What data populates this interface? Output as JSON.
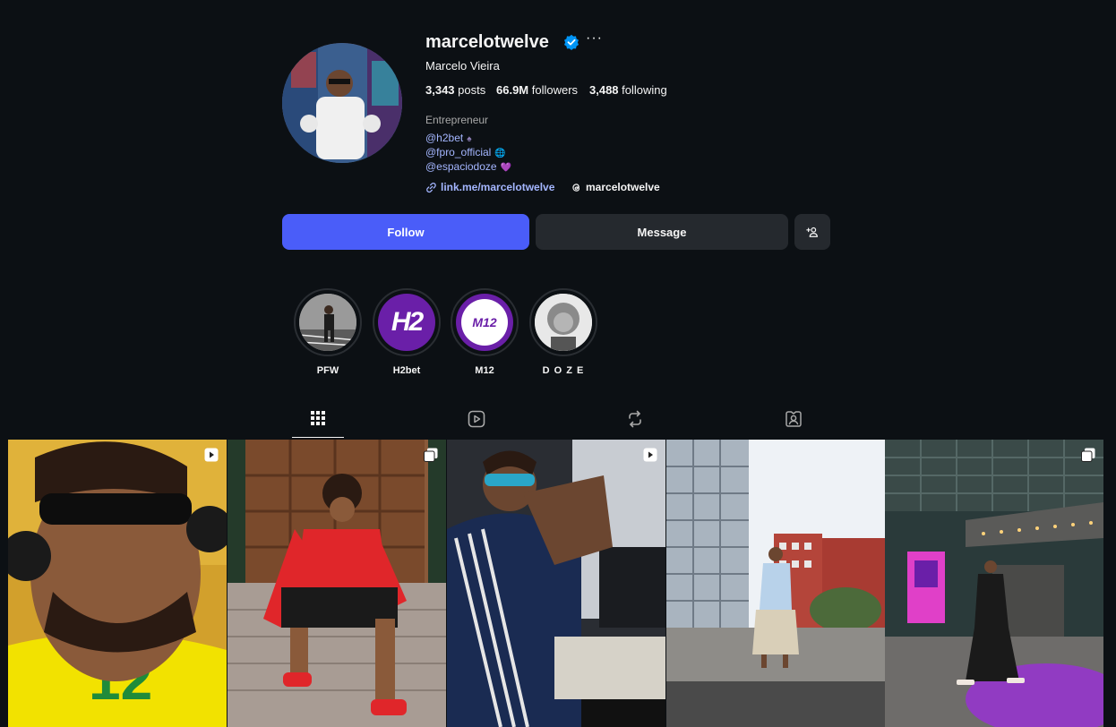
{
  "profile": {
    "username": "marcelotwelve",
    "full_name": "Marcelo Vieira",
    "more_label": "···",
    "stats": {
      "posts_count": "3,343",
      "posts_label": " posts",
      "followers_count": "66.9M",
      "followers_label": " followers",
      "following_count": "3,488",
      "following_label": " following"
    },
    "bio": {
      "role": "Entrepreneur",
      "mentions": [
        {
          "text": "@h2bet",
          "emoji": "♠"
        },
        {
          "text": "@fpro_official",
          "emoji": "🌐"
        },
        {
          "text": "@espaciodoze",
          "emoji": "💜"
        }
      ]
    },
    "link": "link.me/marcelotwelve",
    "threads_handle": "marcelotwelve"
  },
  "actions": {
    "follow_label": "Follow",
    "message_label": "Message"
  },
  "highlights": [
    {
      "label": "PFW",
      "icon": "highlight-pfw"
    },
    {
      "label": "H2bet",
      "icon": "highlight-h2bet",
      "logo_text": "H2"
    },
    {
      "label": "M12",
      "icon": "highlight-m12",
      "logo_text": "M12"
    },
    {
      "label": "D O Z E",
      "icon": "highlight-doze"
    }
  ],
  "tabs": [
    {
      "name": "posts",
      "icon": "grid-icon",
      "active": true
    },
    {
      "name": "reels",
      "icon": "reels-icon",
      "active": false
    },
    {
      "name": "reposts",
      "icon": "repost-icon",
      "active": false
    },
    {
      "name": "tagged",
      "icon": "tagged-icon",
      "active": false
    }
  ],
  "posts": [
    {
      "type": "reel",
      "icon": "reel-icon"
    },
    {
      "type": "carousel",
      "icon": "carousel-icon"
    },
    {
      "type": "reel",
      "icon": "reel-icon"
    },
    {
      "type": "photo",
      "icon": ""
    },
    {
      "type": "carousel",
      "icon": "carousel-icon"
    }
  ],
  "colors": {
    "background": "#0c1014",
    "follow_button": "#4a5df9",
    "secondary_button": "#25292e",
    "link": "#a4b6ff",
    "verified": "#0095f6",
    "h2bet_purple": "#6a1fa8"
  }
}
